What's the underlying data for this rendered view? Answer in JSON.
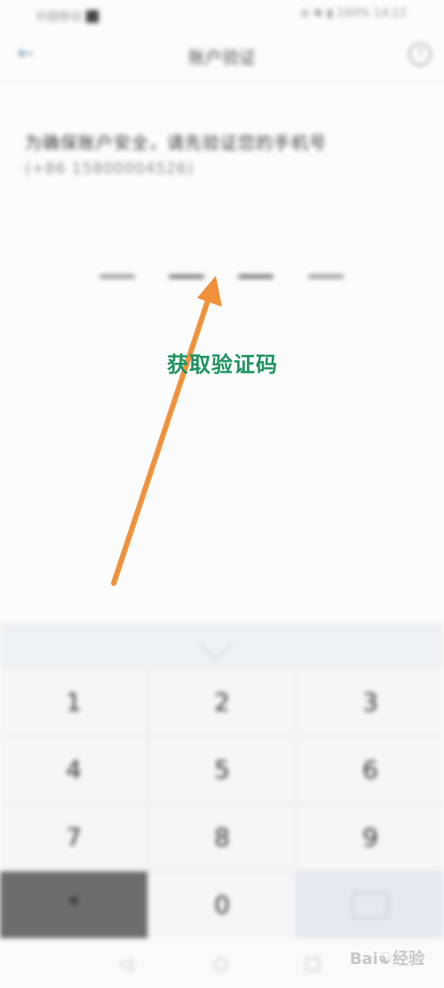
{
  "status_bar": {
    "left": "中国移动 ⬛",
    "right": "⊕ ✱ ▮ 100% 14:12"
  },
  "nav": {
    "back_icon": "arrow-left-icon",
    "title": "账户验证",
    "help_icon": "help-circle-icon"
  },
  "content": {
    "prompt": "为确保账户安全，请先验证您的手机号",
    "phone": "(+86 15800004526)"
  },
  "keypad": {
    "keys": [
      "1",
      "2",
      "3",
      "4",
      "5",
      "6",
      "7",
      "8",
      "9",
      "*",
      "0",
      ""
    ]
  },
  "annotation": {
    "label": "获取验证码",
    "color": "#1d9260",
    "arrow_color": "#f0903a"
  },
  "watermark": "Bai☯经验"
}
